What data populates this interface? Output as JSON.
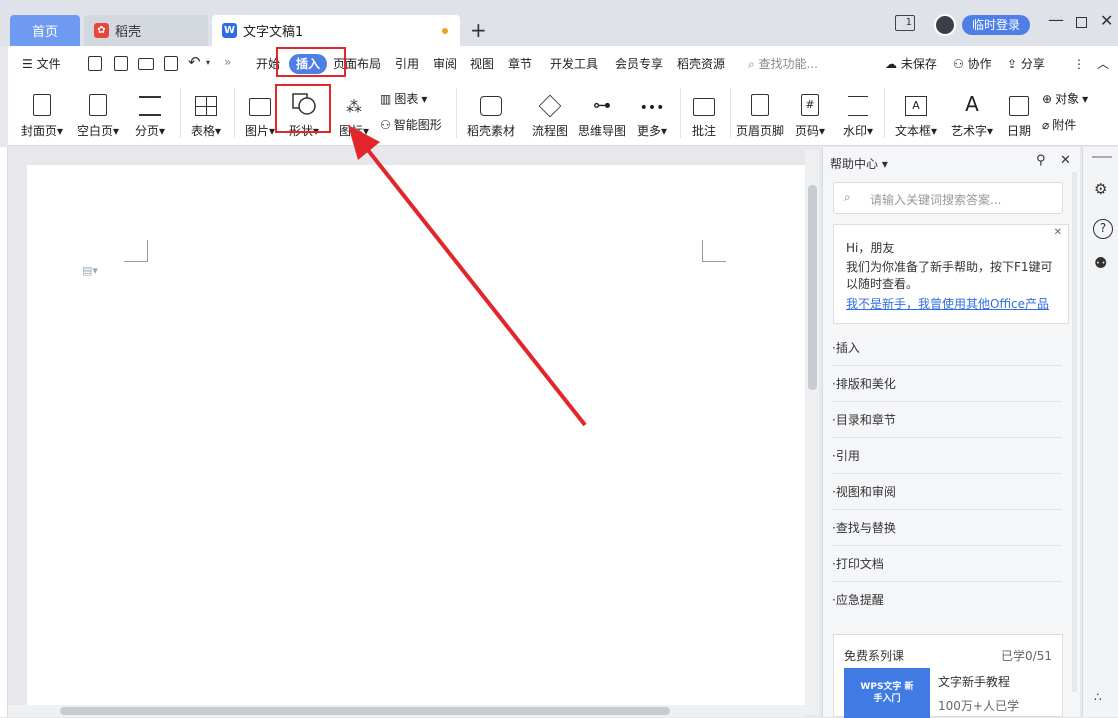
{
  "tabs": {
    "home": "首页",
    "daoke": "稻壳",
    "doc": "文字文稿1",
    "new_tab": "+"
  },
  "titlebar": {
    "login": "临时登录",
    "layout_icon": "1"
  },
  "menu": {
    "file": "文件",
    "items": [
      "开始",
      "插入",
      "页面布局",
      "引用",
      "审阅",
      "视图",
      "章节",
      "开发工具",
      "会员专享",
      "稻壳资源"
    ],
    "search": "查找功能...",
    "unsaved": "未保存",
    "collab": "协作",
    "share": "分享"
  },
  "ribbon": {
    "cover": "封面页",
    "blank": "空白页",
    "pagebreak": "分页",
    "table": "表格",
    "picture": "图片",
    "shape": "形状",
    "icon": "图标",
    "chart": "图表",
    "smartart": "智能图形",
    "daoke_material": "稻壳素材",
    "flowchart": "流程图",
    "mindmap": "思维导图",
    "more": "更多",
    "comment": "批注",
    "header_footer": "页眉页脚",
    "page_number": "页码",
    "watermark": "水印",
    "textbox": "文本框",
    "wordart": "艺术字",
    "date": "日期",
    "object": "对象",
    "attachment": "附件"
  },
  "help": {
    "title": "帮助中心",
    "search_placeholder": "请输入关键词搜索答案...",
    "greeting": "Hi，朋友",
    "message": "我们为你准备了新手帮助，按下F1键可以随时查看。",
    "link": "我不是新手，我曾使用其他Office产品",
    "items": [
      "插入",
      "排版和美化",
      "目录和章节",
      "引用",
      "视图和审阅",
      "查找与替换",
      "打印文档",
      "应急提醒"
    ],
    "course_section": "免费系列课",
    "course_progress": "已学0/51",
    "course_thumb": "WPS文字 新手入门",
    "course_title": "文字新手教程",
    "course_learners": "100万+人已学"
  },
  "colors": {
    "accent": "#4d7fe6",
    "highlight_red": "#e3262c"
  }
}
